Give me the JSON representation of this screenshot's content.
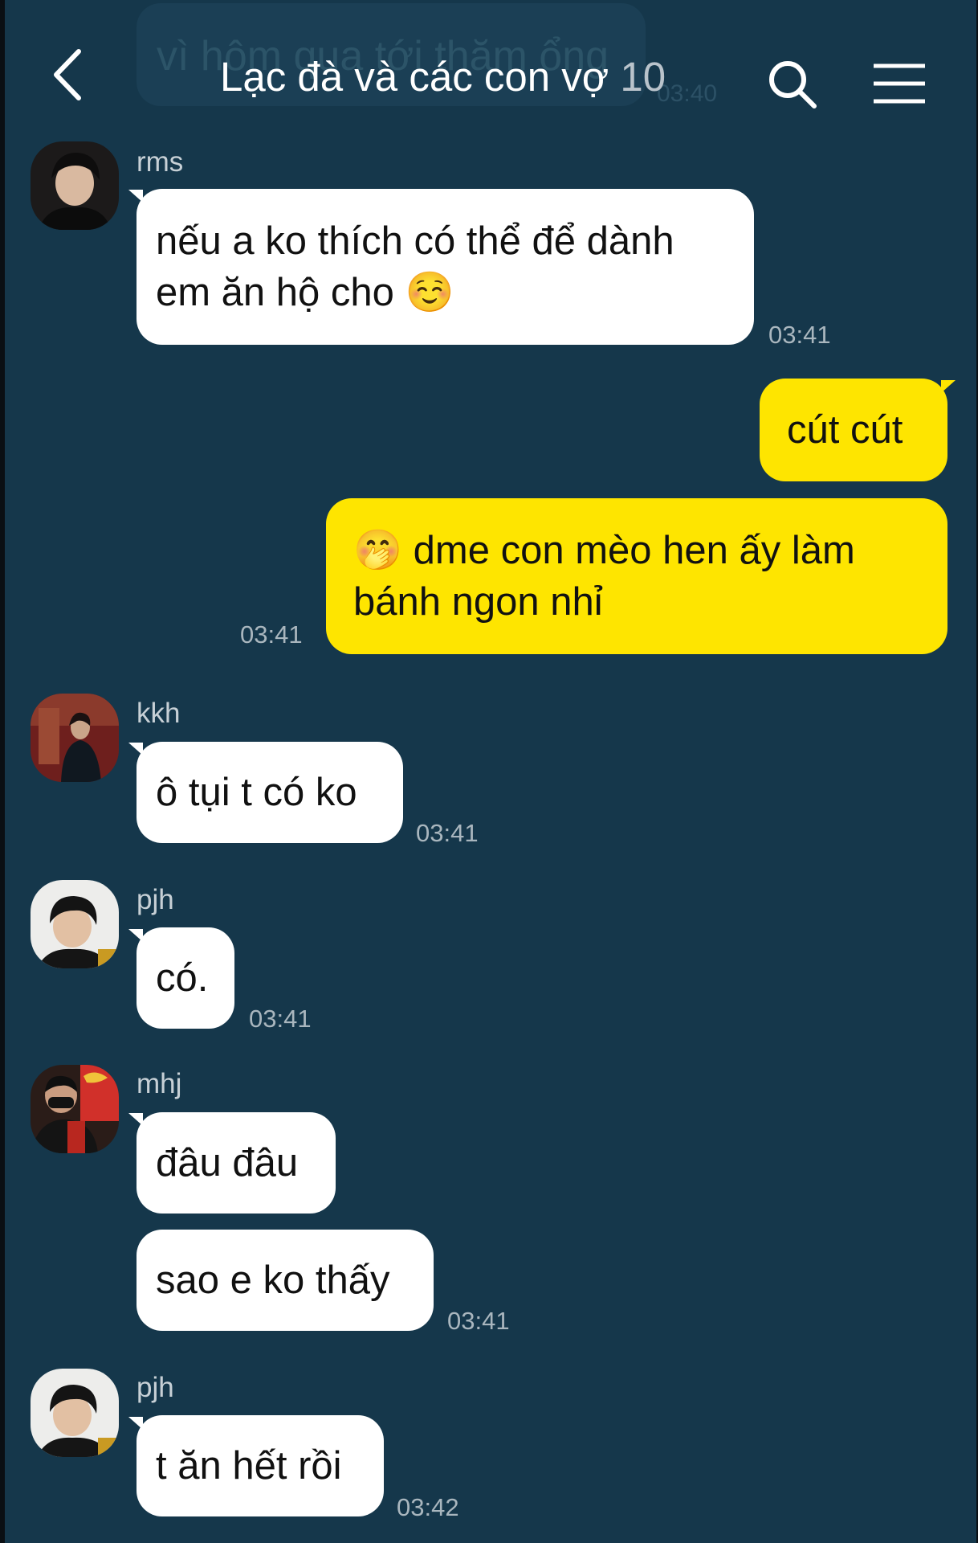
{
  "header": {
    "title": "Lạc đà và các con vợ",
    "member_count": "10",
    "colors": {
      "background": "#15374b",
      "title": "#ffffff",
      "count": "#b9c3cb"
    },
    "icons": {
      "back": "chevron-left-icon",
      "search": "search-icon",
      "menu": "menu-icon"
    }
  },
  "behind_header": {
    "text": "vì hôm qua tới thăm ổng",
    "time": "03:40"
  },
  "colors": {
    "incoming_bubble": "#ffffff",
    "outgoing_bubble": "#fee500",
    "timestamp": "#a9b6be",
    "sender_name": "#c7d0d6"
  },
  "messages": [
    {
      "sender": "rms",
      "direction": "incoming",
      "lines": [
        "nếu a ko thích có thể để dành",
        "em ăn hộ cho"
      ],
      "emoji": "☺️",
      "time": "03:41"
    },
    {
      "direction": "outgoing",
      "lines": [
        "cút cút"
      ]
    },
    {
      "direction": "outgoing",
      "emoji": "🤭",
      "lines": [
        "dme con mèo hen ấy làm",
        "bánh ngon nhỉ"
      ],
      "time": "03:41"
    },
    {
      "sender": "kkh",
      "direction": "incoming",
      "lines": [
        "ô tụi t có ko"
      ],
      "time": "03:41"
    },
    {
      "sender": "pjh",
      "direction": "incoming",
      "lines": [
        "có."
      ],
      "time": "03:41"
    },
    {
      "sender": "mhj",
      "direction": "incoming",
      "lines": [
        "đâu đâu"
      ]
    },
    {
      "direction": "incoming",
      "lines": [
        "sao e ko thấy"
      ],
      "time": "03:41"
    },
    {
      "sender": "pjh",
      "direction": "incoming",
      "lines": [
        "t ăn hết rồi"
      ],
      "time": "03:42"
    }
  ]
}
